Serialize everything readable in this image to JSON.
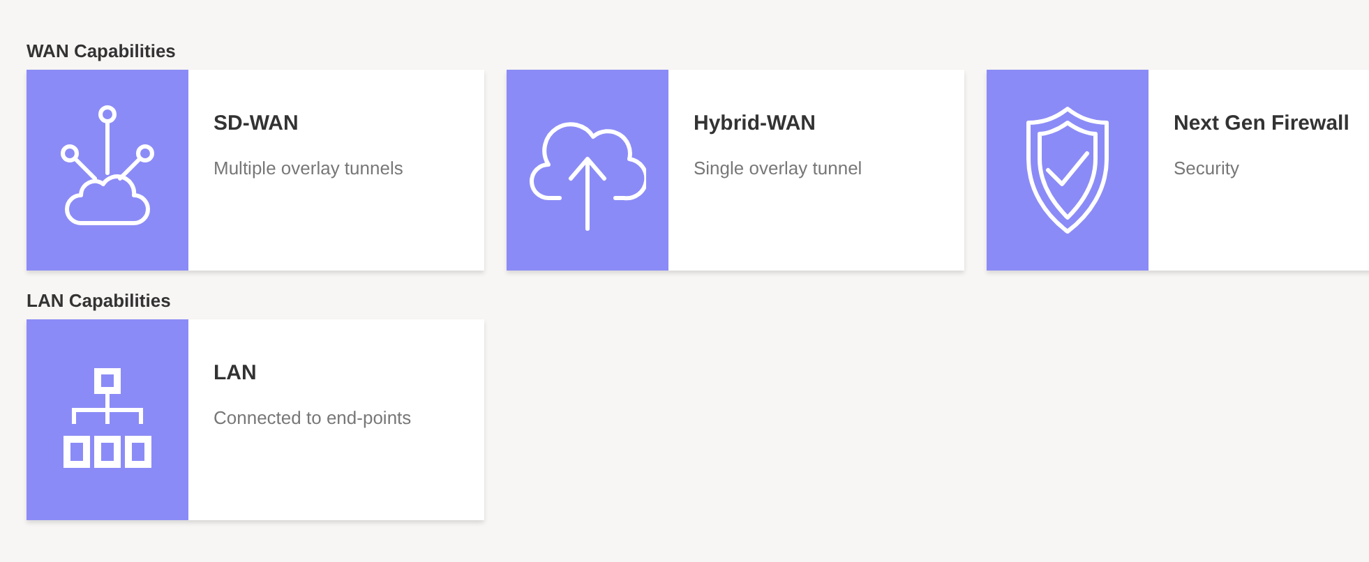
{
  "sections": [
    {
      "title": "WAN Capabilities",
      "cards": [
        {
          "kind": "network",
          "title": "SD-WAN",
          "description": "Multiple overlay tunnels"
        },
        {
          "kind": "cloud-upload",
          "title": "Hybrid-WAN",
          "description": "Single overlay tunnel"
        },
        {
          "kind": "shield",
          "title": "Next Gen Firewall",
          "description": "Security"
        }
      ]
    },
    {
      "title": "LAN Capabilities",
      "cards": [
        {
          "kind": "hierarchy",
          "title": "LAN",
          "description": "Connected to end-points"
        }
      ]
    }
  ]
}
